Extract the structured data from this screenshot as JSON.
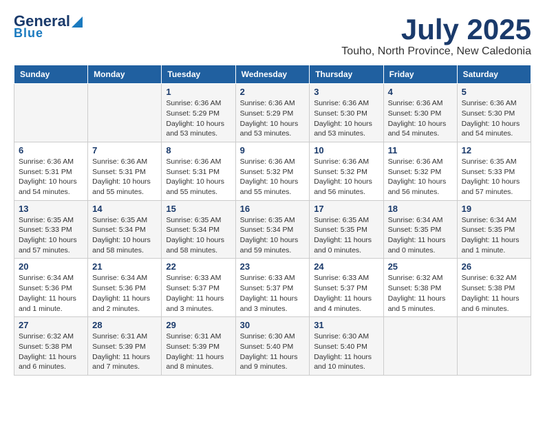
{
  "logo": {
    "line1": "General",
    "line2": "Blue"
  },
  "title": "July 2025",
  "subtitle": "Touho, North Province, New Caledonia",
  "days_of_week": [
    "Sunday",
    "Monday",
    "Tuesday",
    "Wednesday",
    "Thursday",
    "Friday",
    "Saturday"
  ],
  "weeks": [
    [
      {
        "day": "",
        "info": ""
      },
      {
        "day": "",
        "info": ""
      },
      {
        "day": "1",
        "info": "Sunrise: 6:36 AM\nSunset: 5:29 PM\nDaylight: 10 hours and 53 minutes."
      },
      {
        "day": "2",
        "info": "Sunrise: 6:36 AM\nSunset: 5:29 PM\nDaylight: 10 hours and 53 minutes."
      },
      {
        "day": "3",
        "info": "Sunrise: 6:36 AM\nSunset: 5:30 PM\nDaylight: 10 hours and 53 minutes."
      },
      {
        "day": "4",
        "info": "Sunrise: 6:36 AM\nSunset: 5:30 PM\nDaylight: 10 hours and 54 minutes."
      },
      {
        "day": "5",
        "info": "Sunrise: 6:36 AM\nSunset: 5:30 PM\nDaylight: 10 hours and 54 minutes."
      }
    ],
    [
      {
        "day": "6",
        "info": "Sunrise: 6:36 AM\nSunset: 5:31 PM\nDaylight: 10 hours and 54 minutes."
      },
      {
        "day": "7",
        "info": "Sunrise: 6:36 AM\nSunset: 5:31 PM\nDaylight: 10 hours and 55 minutes."
      },
      {
        "day": "8",
        "info": "Sunrise: 6:36 AM\nSunset: 5:31 PM\nDaylight: 10 hours and 55 minutes."
      },
      {
        "day": "9",
        "info": "Sunrise: 6:36 AM\nSunset: 5:32 PM\nDaylight: 10 hours and 55 minutes."
      },
      {
        "day": "10",
        "info": "Sunrise: 6:36 AM\nSunset: 5:32 PM\nDaylight: 10 hours and 56 minutes."
      },
      {
        "day": "11",
        "info": "Sunrise: 6:36 AM\nSunset: 5:32 PM\nDaylight: 10 hours and 56 minutes."
      },
      {
        "day": "12",
        "info": "Sunrise: 6:35 AM\nSunset: 5:33 PM\nDaylight: 10 hours and 57 minutes."
      }
    ],
    [
      {
        "day": "13",
        "info": "Sunrise: 6:35 AM\nSunset: 5:33 PM\nDaylight: 10 hours and 57 minutes."
      },
      {
        "day": "14",
        "info": "Sunrise: 6:35 AM\nSunset: 5:34 PM\nDaylight: 10 hours and 58 minutes."
      },
      {
        "day": "15",
        "info": "Sunrise: 6:35 AM\nSunset: 5:34 PM\nDaylight: 10 hours and 58 minutes."
      },
      {
        "day": "16",
        "info": "Sunrise: 6:35 AM\nSunset: 5:34 PM\nDaylight: 10 hours and 59 minutes."
      },
      {
        "day": "17",
        "info": "Sunrise: 6:35 AM\nSunset: 5:35 PM\nDaylight: 11 hours and 0 minutes."
      },
      {
        "day": "18",
        "info": "Sunrise: 6:34 AM\nSunset: 5:35 PM\nDaylight: 11 hours and 0 minutes."
      },
      {
        "day": "19",
        "info": "Sunrise: 6:34 AM\nSunset: 5:35 PM\nDaylight: 11 hours and 1 minute."
      }
    ],
    [
      {
        "day": "20",
        "info": "Sunrise: 6:34 AM\nSunset: 5:36 PM\nDaylight: 11 hours and 1 minute."
      },
      {
        "day": "21",
        "info": "Sunrise: 6:34 AM\nSunset: 5:36 PM\nDaylight: 11 hours and 2 minutes."
      },
      {
        "day": "22",
        "info": "Sunrise: 6:33 AM\nSunset: 5:37 PM\nDaylight: 11 hours and 3 minutes."
      },
      {
        "day": "23",
        "info": "Sunrise: 6:33 AM\nSunset: 5:37 PM\nDaylight: 11 hours and 3 minutes."
      },
      {
        "day": "24",
        "info": "Sunrise: 6:33 AM\nSunset: 5:37 PM\nDaylight: 11 hours and 4 minutes."
      },
      {
        "day": "25",
        "info": "Sunrise: 6:32 AM\nSunset: 5:38 PM\nDaylight: 11 hours and 5 minutes."
      },
      {
        "day": "26",
        "info": "Sunrise: 6:32 AM\nSunset: 5:38 PM\nDaylight: 11 hours and 6 minutes."
      }
    ],
    [
      {
        "day": "27",
        "info": "Sunrise: 6:32 AM\nSunset: 5:38 PM\nDaylight: 11 hours and 6 minutes."
      },
      {
        "day": "28",
        "info": "Sunrise: 6:31 AM\nSunset: 5:39 PM\nDaylight: 11 hours and 7 minutes."
      },
      {
        "day": "29",
        "info": "Sunrise: 6:31 AM\nSunset: 5:39 PM\nDaylight: 11 hours and 8 minutes."
      },
      {
        "day": "30",
        "info": "Sunrise: 6:30 AM\nSunset: 5:40 PM\nDaylight: 11 hours and 9 minutes."
      },
      {
        "day": "31",
        "info": "Sunrise: 6:30 AM\nSunset: 5:40 PM\nDaylight: 11 hours and 10 minutes."
      },
      {
        "day": "",
        "info": ""
      },
      {
        "day": "",
        "info": ""
      }
    ]
  ]
}
